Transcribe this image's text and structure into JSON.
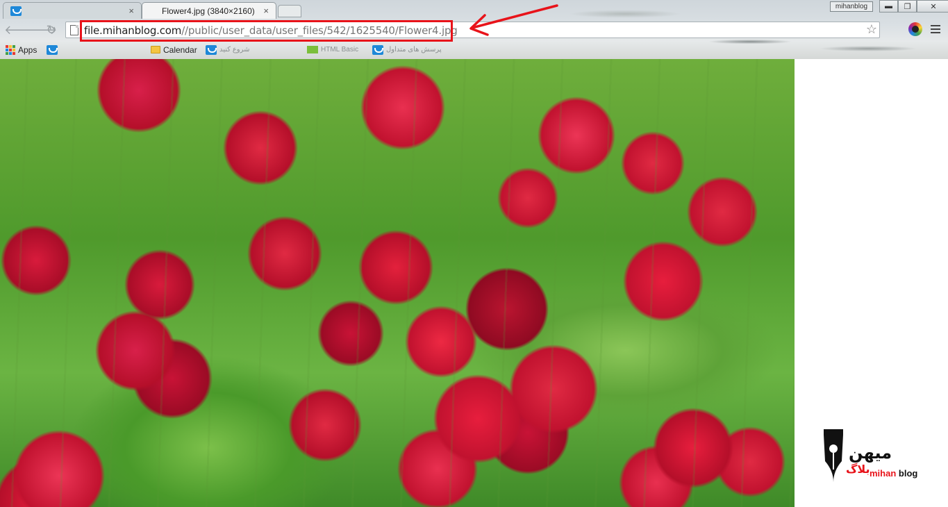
{
  "tabs": [
    {
      "title": "",
      "close": "×",
      "active": false
    },
    {
      "title": "Flower4.jpg (3840×2160)",
      "close": "×",
      "active": true
    }
  ],
  "profile_chip": "mihanblog",
  "window_buttons": {
    "minimize": "▬",
    "maximize": "❐",
    "close": "✕"
  },
  "toolbar": {
    "back_icon": "🡐",
    "forward_icon": "🡒",
    "reload_icon": "↻",
    "url_host": "file.mihanblog.com",
    "url_path": "//public/user_data/user_files/542/1625540/Flower4.jpg",
    "star_icon": "☆"
  },
  "bookmarks": {
    "apps_label": "Apps",
    "calendar_label": "Calendar",
    "grey1": "شروع کنید",
    "grey2": "HTML Basic",
    "grey3": "پرسش های متداول"
  },
  "annotation_color": "#e8131a",
  "logo": {
    "fa_main": "میهن",
    "fa_sub": "بلاگ",
    "en_a": "mihan",
    "en_b": "blog"
  }
}
